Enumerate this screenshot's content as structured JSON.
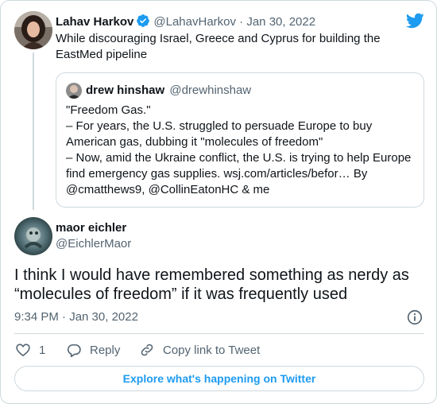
{
  "parent_tweet": {
    "author_name": "Lahav Harkov",
    "handle": "@LahavHarkov",
    "separator": "·",
    "date": "Jan 30, 2022",
    "text": "While discouraging Israel, Greece and Cyprus for building the EastMed pipeline",
    "verified_icon": "verified-badge-icon"
  },
  "quoted_tweet": {
    "author_name": "drew hinshaw",
    "handle": "@drewhinshaw",
    "lines": [
      "\"Freedom Gas.\"",
      "– For years, the U.S. struggled to persuade Europe to buy",
      "American gas, dubbing it \"molecules of freedom\"",
      "– Now, amid the Ukraine conflict, the U.S. is trying to help Europe",
      "find emergency gas supplies. wsj.com/articles/befor… By",
      "@cmatthews9, @CollinEatonHC & me"
    ]
  },
  "main_tweet": {
    "author_name": "maor eichler",
    "handle": "@EichlerMaor",
    "text": "I think I would have remembered something as nerdy as “molecules of freedom” if it was frequently used",
    "timestamp": "9:34 PM · Jan 30, 2022"
  },
  "actions": {
    "like_count": "1",
    "reply_label": "Reply",
    "copy_label": "Copy link to Tweet"
  },
  "explore_label": "Explore what's happening on Twitter",
  "colors": {
    "accent": "#1d9bf0",
    "text_primary": "#0f1419",
    "text_secondary": "#536471",
    "border": "#cfd9de"
  },
  "icons": [
    "twitter-bird-icon",
    "verified-badge-icon",
    "info-icon",
    "heart-icon",
    "reply-bubble-icon",
    "link-icon"
  ]
}
